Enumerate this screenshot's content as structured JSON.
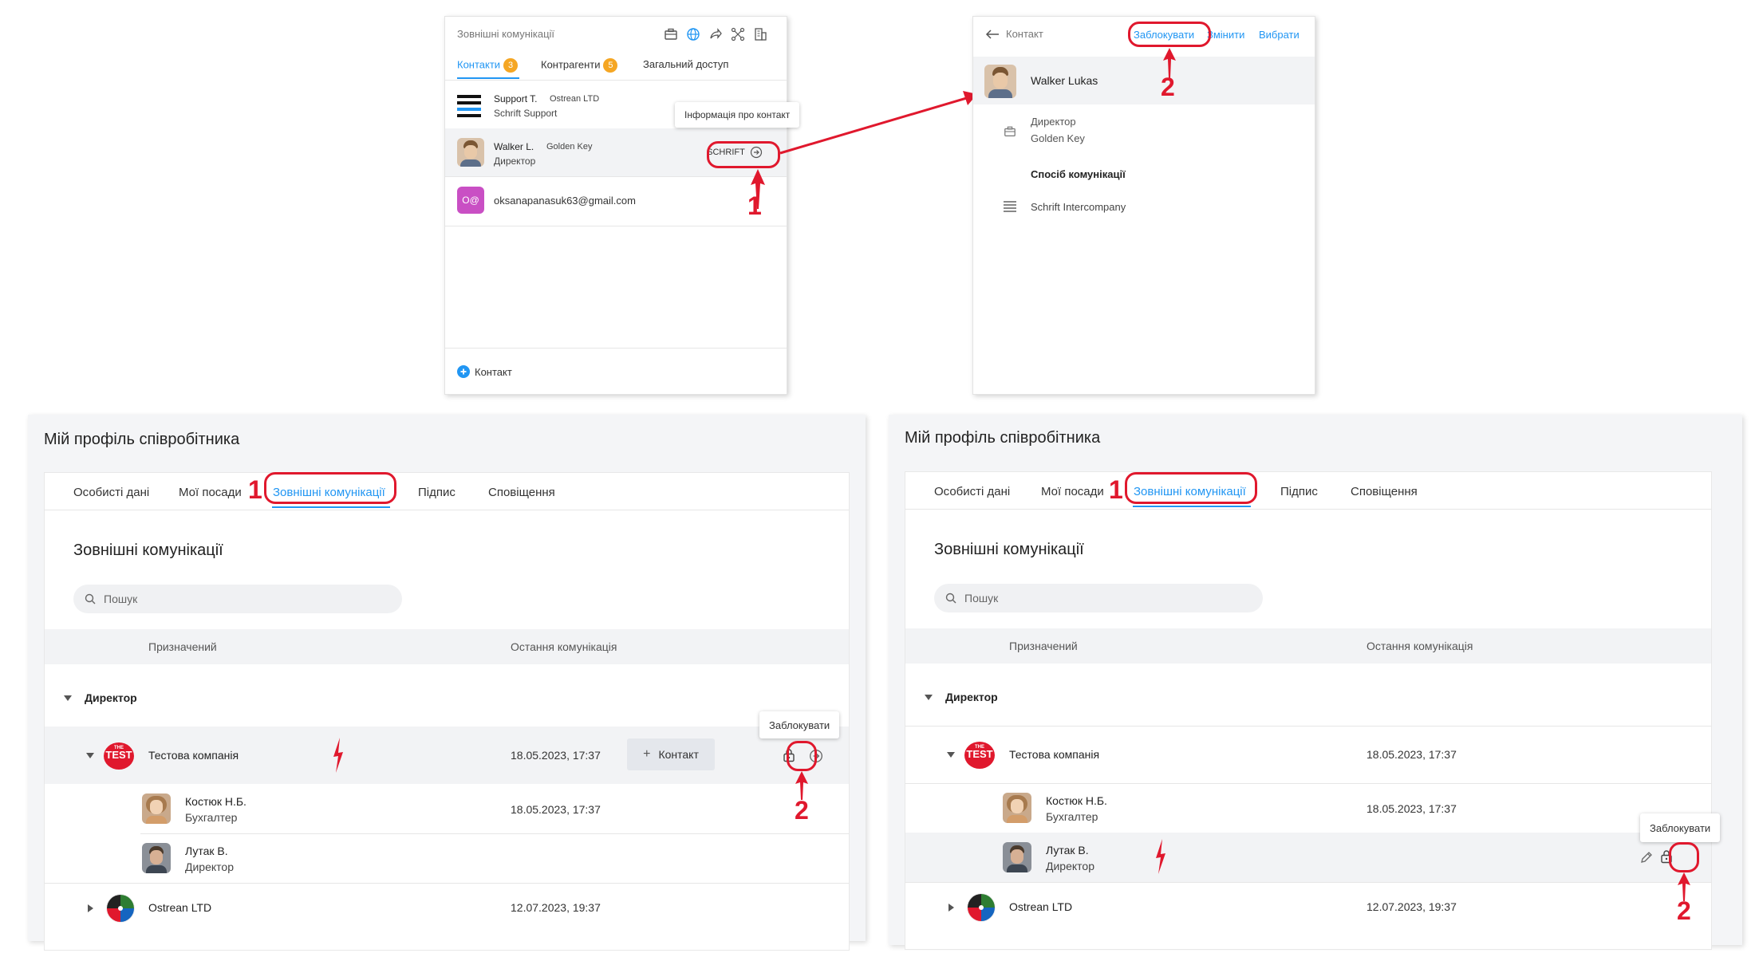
{
  "panel1": {
    "title": "Зовнішні комунікації",
    "tabs": [
      {
        "label": "Контакти",
        "badge": "3"
      },
      {
        "label": "Контрагенти",
        "badge": "5"
      },
      {
        "label": "Загальний доступ"
      }
    ],
    "contacts": [
      {
        "name": "Support T.",
        "company": "Ostrean LTD",
        "sub": "Schrift Support"
      },
      {
        "name": "Walker L.",
        "company": "Golden Key",
        "sub": "Директор",
        "button": "SCHRIFT"
      },
      {
        "name": "oksanapanasuk63@gmail.com",
        "initials": "O@"
      }
    ],
    "tooltip": "Інформація про контакт",
    "add_contact": "Контакт"
  },
  "panel2": {
    "back_label": "Контакт",
    "actions": {
      "block": "Заблокувати",
      "edit": "Змінити",
      "choose": "Вибрати"
    },
    "person_name": "Walker Lukas",
    "position": "Директор",
    "company": "Golden Key",
    "comm_heading": "Спосіб комунікації",
    "comm_method": "Schrift Intercompany"
  },
  "profile_left": {
    "page_title": "Мій профіль співробітника",
    "tabs": [
      "Особисті дані",
      "Мої посади",
      "Зовнішні комунікації",
      "Підпис",
      "Сповіщення"
    ],
    "section_title": "Зовнішні комунікації",
    "search_placeholder": "Пошук",
    "col_assigned": "Призначений",
    "col_last": "Остання комунікація",
    "group": "Директор",
    "company1": {
      "name": "Тестова компанія",
      "date": "18.05.2023, 17:37",
      "logo_text": "TEST",
      "logo_small": "THE"
    },
    "add_contact_btn": "Контакт",
    "tooltip": "Заблокувати",
    "people": [
      {
        "name": "Костюк Н.Б.",
        "role": "Бухгалтер",
        "date": "18.05.2023, 17:37"
      },
      {
        "name": "Лутак В.",
        "role": "Директор",
        "date": ""
      }
    ],
    "company2": {
      "name": "Ostrean LTD",
      "date": "12.07.2023, 19:37"
    }
  },
  "profile_right": {
    "page_title": "Мій профіль співробітника",
    "tabs": [
      "Особисті дані",
      "Мої посади",
      "Зовнішні комунікації",
      "Підпис",
      "Сповіщення"
    ],
    "section_title": "Зовнішні комунікації",
    "search_placeholder": "Пошук",
    "col_assigned": "Призначений",
    "col_last": "Остання комунікація",
    "group": "Директор",
    "company1": {
      "name": "Тестова компанія",
      "date": "18.05.2023, 17:37",
      "logo_text": "TEST",
      "logo_small": "THE"
    },
    "tooltip": "Заблокувати",
    "people": [
      {
        "name": "Костюк Н.Б.",
        "role": "Бухгалтер",
        "date": "18.05.2023, 17:37"
      },
      {
        "name": "Лутак В.",
        "role": "Директор",
        "date": ""
      }
    ],
    "company2": {
      "name": "Ostrean LTD",
      "date": "12.07.2023, 19:37"
    }
  },
  "annotations": {
    "one": "1",
    "two": "2"
  },
  "colors": {
    "accent": "#2196f3",
    "annotation": "#e0182d",
    "badge": "#f5a623",
    "email_avatar": "#c94fc4"
  }
}
